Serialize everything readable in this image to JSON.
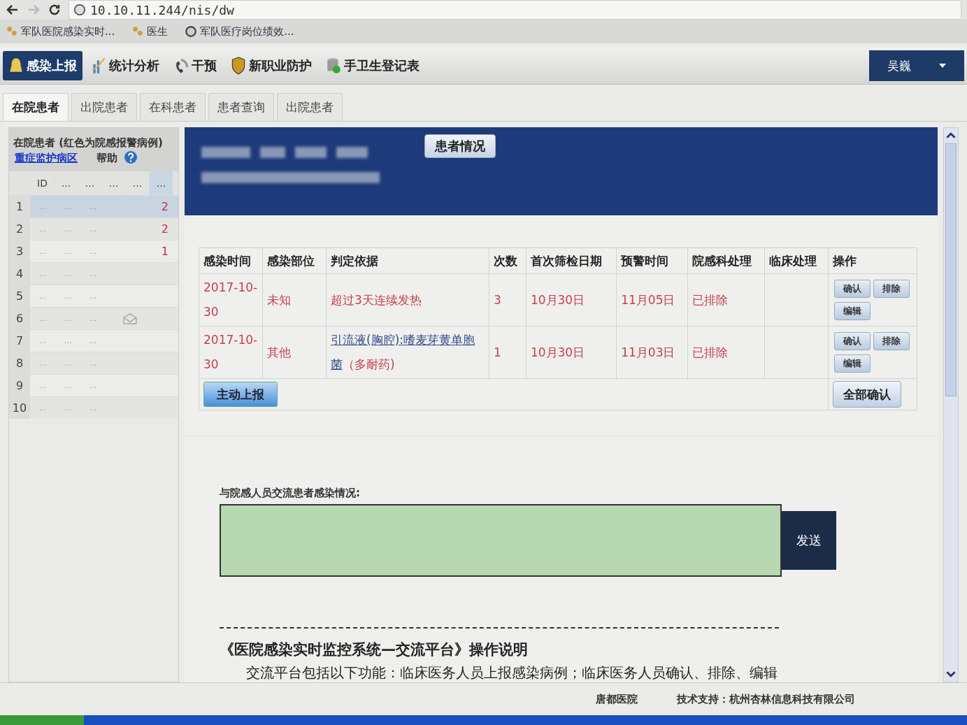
{
  "browser": {
    "url": "10.10.11.244/nis/dw"
  },
  "bookmarks": [
    {
      "label": "军队医院感染实时..."
    },
    {
      "label": "医生"
    },
    {
      "label": "军队医疗岗位绩效..."
    }
  ],
  "app_nav": {
    "items": [
      {
        "label": "感染上报",
        "selected": true
      },
      {
        "label": "统计分析",
        "selected": false
      },
      {
        "label": "干预",
        "selected": false
      },
      {
        "label": "新职业防护",
        "selected": false
      },
      {
        "label": "手卫生登记表",
        "selected": false
      }
    ],
    "user": "吴巍"
  },
  "tabs": [
    {
      "label": "在院患者",
      "selected": true
    },
    {
      "label": "出院患者",
      "selected": false
    },
    {
      "label": "在科患者",
      "selected": false
    },
    {
      "label": "患者查询",
      "selected": false
    },
    {
      "label": "出院患者",
      "selected": false
    }
  ],
  "patient_list": {
    "title": "在院患者 (红色为院感报警病例)",
    "ward_link": "重症监护病区",
    "help": "帮助",
    "columns": [
      "ID",
      "...",
      "...",
      "...",
      "...",
      "..."
    ],
    "rows": [
      {
        "no": "1",
        "cells": [
          "...",
          "...",
          "..."
        ],
        "message": false,
        "count": "2",
        "selected": true
      },
      {
        "no": "2",
        "cells": [
          "...",
          "...",
          "..."
        ],
        "message": false,
        "count": "2",
        "selected": false
      },
      {
        "no": "3",
        "cells": [
          "...",
          "...",
          "..."
        ],
        "message": false,
        "count": "1",
        "selected": false
      },
      {
        "no": "4",
        "cells": [
          "...",
          "...",
          "..."
        ],
        "message": false,
        "selected": false
      },
      {
        "no": "5",
        "cells": [
          "...",
          "...",
          "..."
        ],
        "message": false,
        "selected": false
      },
      {
        "no": "6",
        "cells": [
          "...",
          "...",
          "..."
        ],
        "message": true,
        "selected": false
      },
      {
        "no": "7",
        "cells": [
          "...",
          "...",
          "..."
        ],
        "message": false,
        "selected": false
      },
      {
        "no": "8",
        "cells": [
          "...",
          "...",
          "..."
        ],
        "message": false,
        "selected": false
      },
      {
        "no": "9",
        "cells": [
          "...",
          "...",
          "..."
        ],
        "message": false,
        "selected": false
      },
      {
        "no": "10",
        "cells": [
          "...",
          "...",
          "..."
        ],
        "message": false,
        "selected": false
      }
    ]
  },
  "patient_header": {
    "button": "患者情况"
  },
  "infections": {
    "columns": [
      "感染时间",
      "感染部位",
      "判定依据",
      "次数",
      "首次筛检日期",
      "预警时间",
      "院感科处理",
      "临床处理",
      "操作"
    ],
    "rows": [
      {
        "time": "2017-10-30",
        "site": "未知",
        "basis": "超过3天连续发热",
        "count": "3",
        "first_screen": "10月30日",
        "alert_time": "11月05日",
        "dept_action": "已排除",
        "actions": [
          "确认",
          "排除",
          "编辑"
        ]
      },
      {
        "time": "2017-10-30",
        "site": "其他",
        "basis_link": "引流液(胸腔):嗜麦芽黄单胞菌",
        "basis": "（多耐药)",
        "count": "1",
        "first_screen": "10月30日",
        "alert_time": "11月03日",
        "dept_action": "已排除",
        "actions": [
          "确认",
          "排除",
          "编辑"
        ]
      }
    ],
    "report_button": "主动上报",
    "confirm_all_button": "全部确认"
  },
  "communication": {
    "label": "与院感人员交流患者感染情况:",
    "send_button": "发送"
  },
  "instructions": {
    "title": "《医院感染实时监控系统—交流平台》操作说明",
    "text": "交流平台包括以下功能：临床医务人员上报感染病例；临床医务人员确认、排除、编辑"
  },
  "footer": {
    "hospital": "唐都医院",
    "support": "技术支持：杭州杏林信息科技有限公司"
  }
}
